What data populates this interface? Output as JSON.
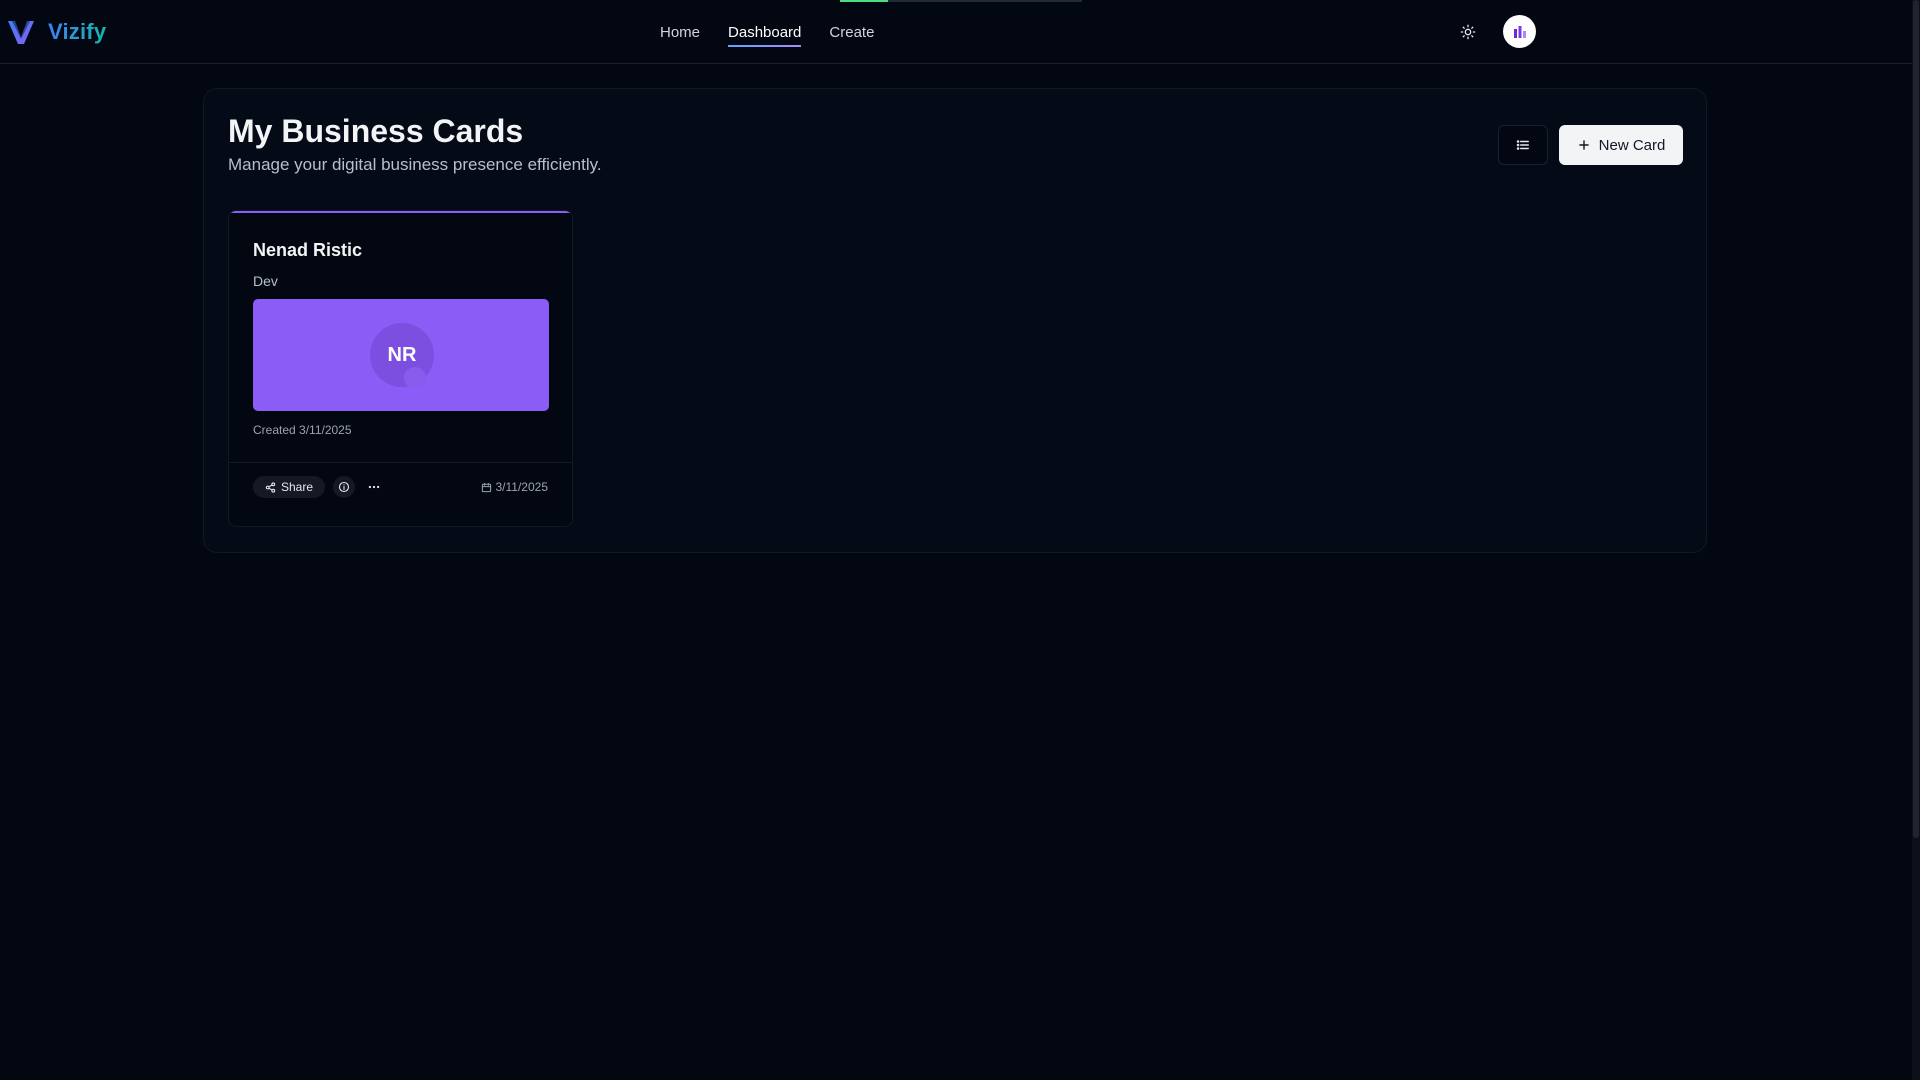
{
  "app": {
    "name": "Vizify"
  },
  "nav": {
    "links": [
      {
        "label": "Home"
      },
      {
        "label": "Dashboard",
        "active": true
      },
      {
        "label": "Create"
      }
    ],
    "loading_progress": 0.2
  },
  "header": {
    "title": "My Business Cards",
    "subtitle": "Manage your digital business presence efficiently.",
    "new_card_label": "New Card"
  },
  "cards": [
    {
      "name": "Nenad Ristic",
      "title": "Dev",
      "initials": "NR",
      "created": "Created 3/11/2025",
      "share_label": "Share",
      "date": "3/11/2025",
      "color": "#8b5cf6"
    }
  ],
  "icons": {
    "theme": "sun-icon",
    "view_toggle": "list-icon",
    "new_card": "plus-icon",
    "share": "share-icon",
    "info": "info-icon",
    "more": "more-horizontal-icon",
    "date": "calendar-icon"
  },
  "colors": {
    "background": "#030712",
    "accent": "#8b5cf6",
    "logo_gradient_start": "#3b82f6",
    "logo_gradient_end": "#14b8a6",
    "progress": "#4ade80"
  }
}
